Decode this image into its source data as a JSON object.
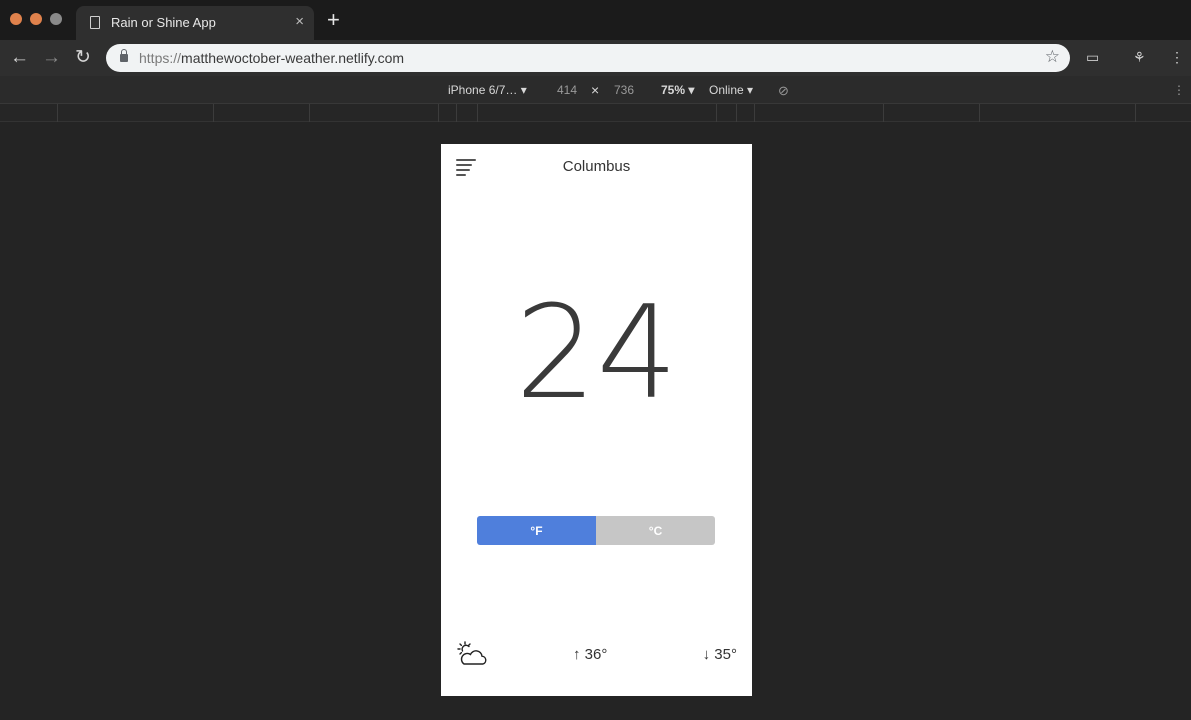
{
  "browser": {
    "tab_title": "Rain or Shine App",
    "tab_close": "×",
    "new_tab": "+",
    "url_scheme": "https://",
    "url_host": "matthewoctober-weather.netlify.com",
    "traffic_colors": [
      "#e0824c",
      "#e0824c",
      "#8a8a8a"
    ]
  },
  "devtools": {
    "device": "iPhone 6/7… ▾",
    "width": "414",
    "times": "×",
    "height": "736",
    "zoom": "75% ▾",
    "network": "Online ▾"
  },
  "app": {
    "city": "Columbus",
    "temperature": "24",
    "unit_f": "°F",
    "unit_c": "°C",
    "active_unit": "F",
    "high": "↑ 36°",
    "low": "↓ 35°",
    "weather_icon": "partly-cloudy-icon"
  }
}
